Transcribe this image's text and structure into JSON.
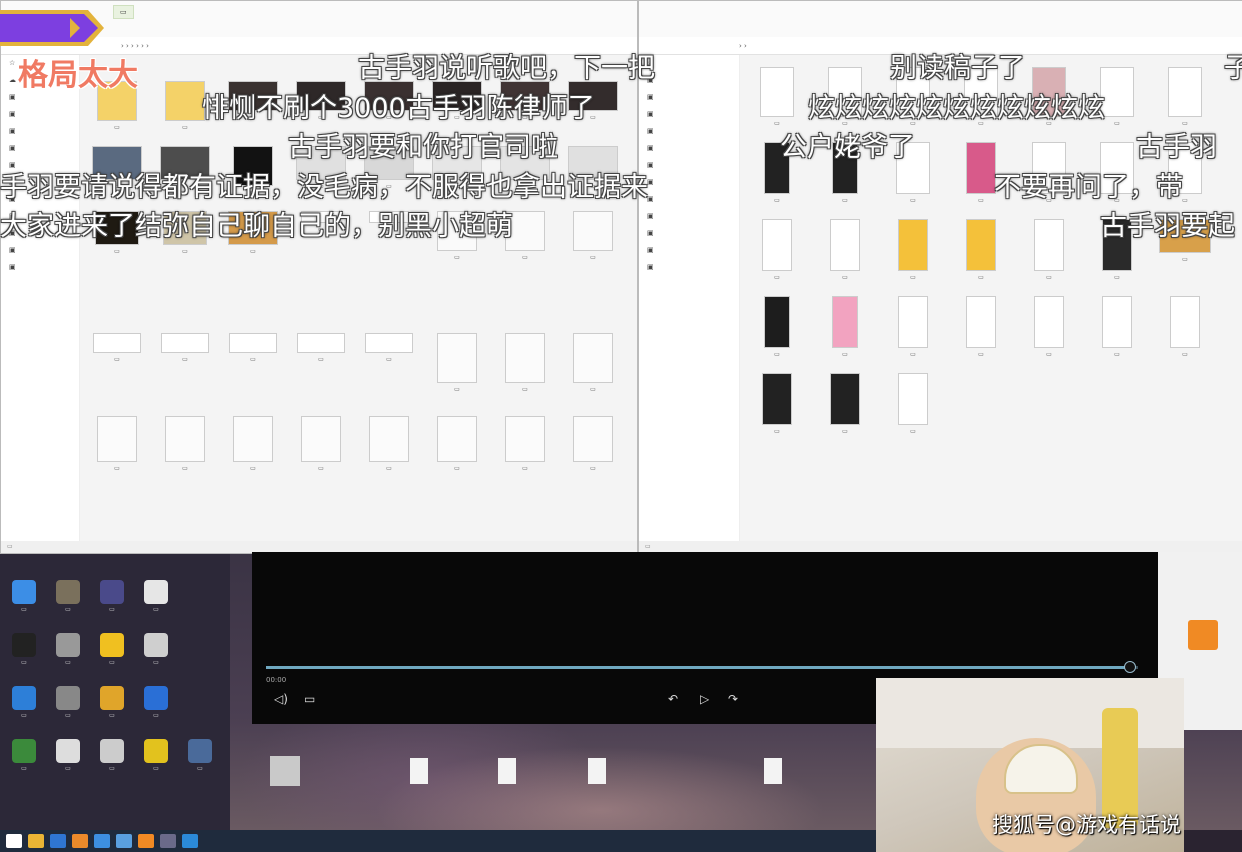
{
  "room_title": "格局太大",
  "danmaku": [
    "古手羽说听歌吧，下一把",
    "别读稿子了",
    "子",
    "悱恻不刷个3000古手羽陈律师了",
    "炫炫炫炫炫炫炫炫炫炫炫",
    "古手羽要和你打官司啦",
    "公户姥爷了",
    "古手羽",
    "手羽要请说得都有证据，没毛病，不服得也拿出证据来",
    "不要再问了，带",
    "大家进来了结弥自己聊自己的，别黑小超萌",
    "古手羽要起"
  ],
  "watermark": "搜狐号@游戏有话说",
  "colors": {
    "title": "#f07a63",
    "badge_purple": "#7d3fe0",
    "badge_gold": "#e3b33c",
    "accent_orange": "#f08a24",
    "progress": "#6fa8c0"
  },
  "player": {
    "time": "00:00",
    "progress": 0.99
  }
}
